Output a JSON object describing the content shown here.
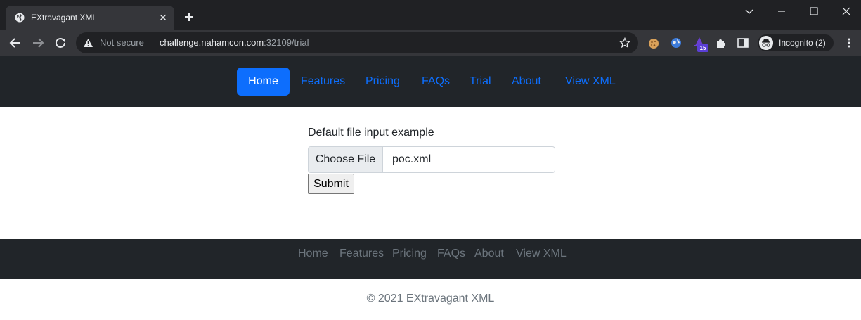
{
  "browser": {
    "tab_title": "EXtravagant XML",
    "tab_close": "✕",
    "security_label": "Not secure",
    "url_host": "challenge.nahamcon.com",
    "url_rest": ":32109/trial",
    "extension_badge": "15",
    "incognito_label": "Incognito (2)",
    "icons": [
      "globe-icon",
      "new-tab-icon",
      "minimize-icon",
      "maximize-icon",
      "close-window-icon",
      "back-icon",
      "forward-icon",
      "reload-icon",
      "warning-icon",
      "star-icon",
      "cookie-icon",
      "vpn-icon",
      "wizard-icon",
      "puzzle-icon",
      "side-panel-icon",
      "incognito-icon",
      "more-menu-icon"
    ]
  },
  "nav": {
    "items": [
      {
        "label": "Home",
        "active": true
      },
      {
        "label": "Features"
      },
      {
        "label": "Pricing"
      },
      {
        "label": "FAQs"
      },
      {
        "label": "Trial"
      },
      {
        "label": "About"
      },
      {
        "label": "View XML"
      }
    ],
    "active_color": "#0d6efd",
    "link_color": "#0d6efd",
    "background": "#212529"
  },
  "form": {
    "label": "Default file input example",
    "choose_file_label": "Choose File",
    "file_name": "poc.xml",
    "submit_label": "Submit"
  },
  "footer": {
    "links": [
      "Home",
      "Features",
      "Pricing",
      "FAQs",
      "About",
      "View XML"
    ],
    "copyright": "© 2021 EXtravagant XML"
  }
}
